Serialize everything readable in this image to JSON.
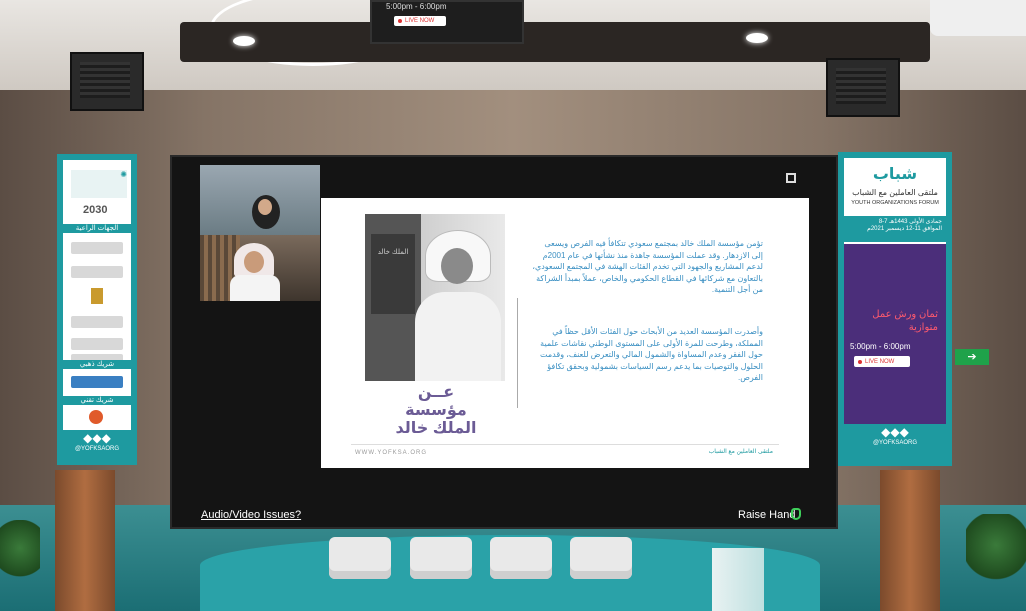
{
  "top_screen": {
    "time": "5:00pm - 6:00pm",
    "live_badge": "LIVE NOW"
  },
  "left_banner": {
    "vision_label": "2030",
    "section1": "الجهات الراعية",
    "section2": "شريك ذهبي",
    "section3": "شريك تقني",
    "social": "@YOFKSAORG"
  },
  "right_banner": {
    "logo_text": "شباب",
    "title_ar": "ملتقى العاملين مع الشباب",
    "title_en": "YOUTH ORGANIZATIONS FORUM",
    "date_ar_line1": "8-7 جمادى الأولى 1443هـ",
    "date_ar_line2": "الموافق 11-12 ديسمبر 2021م",
    "session_title": "ثمان ورش عمل متوازية",
    "time": "5:00pm - 6:00pm",
    "live_badge": "LIVE NOW",
    "social": "@YOFKSAORG"
  },
  "slide": {
    "book_title": "الملك خالد",
    "heading_line1": "عــن",
    "heading_line2": "مؤسسة",
    "heading_line3": "الملك خالد",
    "paragraph1": "تؤمن مؤسسة الملك خالد بمجتمع سعودي تتكافأ فيه الفرص ويسعى إلى الازدهار. وقد عملت المؤسسة جاهدة منذ نشأتها في عام 2001م لدعم المشاريع والجهود التي تخدم الفئات الهشة في المجتمع السعودي، بالتعاون مع شركائها في القطاع الحكومي والخاص، عملاً بمبدأ الشراكة من أجل التنمية.",
    "paragraph2": "وأصدرت المؤسسة العديد من الأبحاث حول الفئات الأقل حظاً في المملكة، وطرحت للمرة الأولى على المستوى الوطني نقاشات علمية حول الفقر وعدم المساواة والشمول المالي والتعرض للعنف، وقدمت الحلول والتوصيات بما يدعم رسم السياسات بشمولية وبحقق تكافؤ الفرص.",
    "footer_url": "WWW.YOFKSA.ORG",
    "footer_logo": "ملتقى العاملين مع الشباب"
  },
  "controls": {
    "av_issues": "Audio/Video Issues?",
    "raise_hand": "Raise Hand"
  },
  "colors": {
    "teal": "#1e9aa0",
    "purple": "#4b2e7a",
    "slide_purple": "#6b5b95",
    "text_blue": "#3a8fc2"
  }
}
